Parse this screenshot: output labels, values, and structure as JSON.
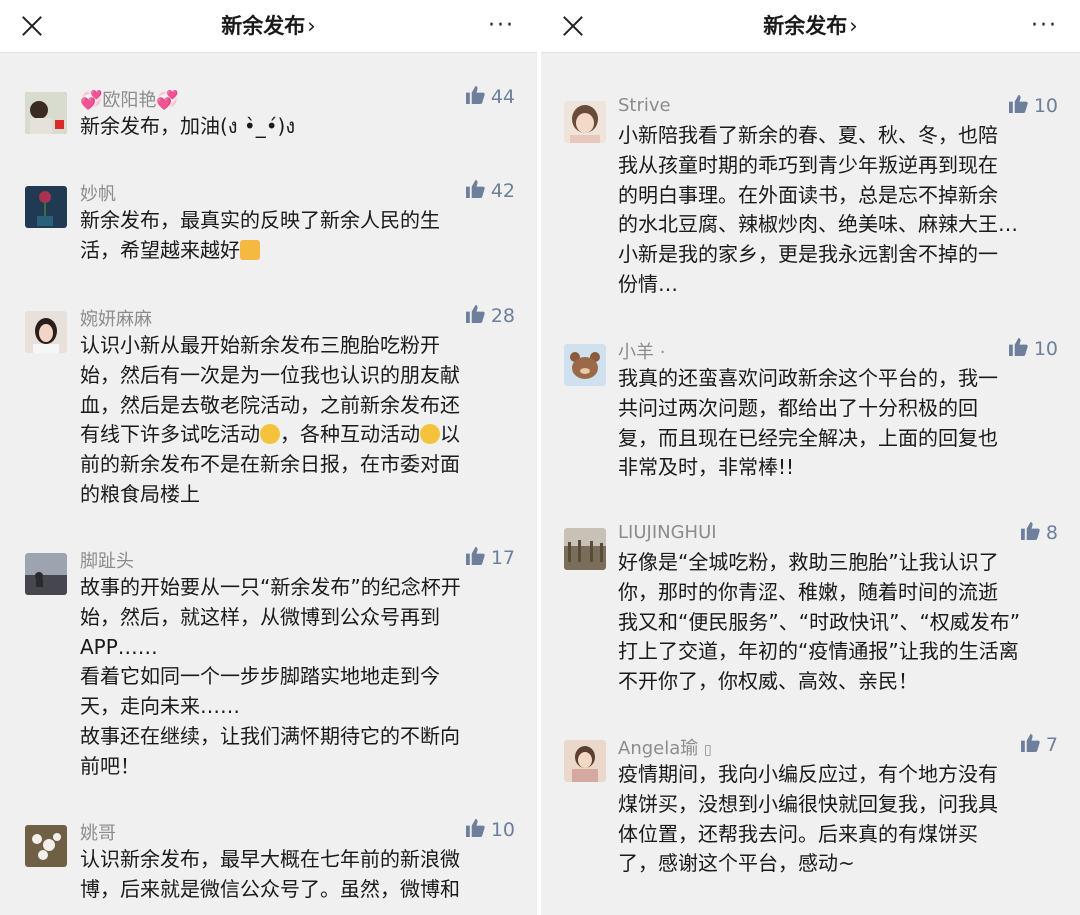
{
  "left": {
    "header": {
      "title": "新余发布",
      "chevron": "›",
      "close_icon": "close-icon",
      "more_icon": "more-icon"
    },
    "comments": [
      {
        "name": "欧阳艳",
        "likes": "44",
        "text": "新余发布，加油(ง •̀_•́)ง",
        "avatar_color": "#4d6a3a"
      },
      {
        "name": "妙帆",
        "likes": "42",
        "text": "新余发布，最真实的反映了新余人民的生\n活，希望越来越好",
        "avatar_color": "#2d4a63"
      },
      {
        "name": "婉妍麻麻",
        "likes": "28",
        "text": "认识小新从最开始新余发布三胞胎吃粉开\n始，然后有一次是为一位我也认识的朋友献\n血，然后是去敬老院活动，之前新余发布还\n有线下许多试吃活动",
        "text2": "，各种互动活动",
        "text3": "以\n前的新余发布不是在新余日报，在市委对面\n的粮食局楼上",
        "avatar_color": "#c9b8b0"
      },
      {
        "name": "脚趾头",
        "likes": "17",
        "text": "故事的开始要从一只“新余发布”的纪念杯开\n始，然后，就这样，从微博到公众号再到\nAPP……\n看着它如同一个一步步脚踏实地地走到今\n天，走向未来……\n故事还在继续，让我们满怀期待它的不断向\n前吧！",
        "avatar_color": "#6d6e78"
      },
      {
        "name": "姚哥",
        "likes": "10",
        "text": "认识新余发布，最早大概在七年前的新浪微\n博，后来就是微信公众号了。虽然，微博和",
        "avatar_color": "#8a7a5a"
      }
    ]
  },
  "right": {
    "header": {
      "title": "新余发布",
      "chevron": "›",
      "close_icon": "close-icon",
      "more_icon": "more-icon"
    },
    "comments": [
      {
        "name": "Strive",
        "likes": "10",
        "text": "小新陪我看了新余的春、夏、秋、冬，也陪\n我从孩童时期的乖巧到青少年叛逆再到现在\n的明白事理。在外面读书，总是忘不掉新余\n的水北豆腐、辣椒炒肉、绝美味、麻辣大王…\n小新是我的家乡，更是我永远割舍不掉的一\n份情…",
        "avatar_color": "#d9b9a5"
      },
      {
        "name": "小羊 ·",
        "likes": "10",
        "text": "我真的还蛮喜欢问政新余这个平台的，我一\n共问过两次问题，都给出了十分积极的回\n复，而且现在已经完全解决，上面的回复也\n非常及时，非常棒!!",
        "avatar_color": "#cfe0ef"
      },
      {
        "name": "LIUJINGHUI",
        "likes": "8",
        "text": "好像是“全城吃粉，救助三胞胎”让我认识了\n你，那时的你青涩、稚嫩，随着时间的流逝\n我又和“便民服务”、“时政快讯”、“权威发布”\n打上了交道，年初的“疫情通报”让我的生活离\n不开你了，你权威、高效、亲民！",
        "avatar_color": "#9a8f7a"
      },
      {
        "name": "Angela瑜",
        "likes": "7",
        "text": "疫情期间，我向小编反应过，有个地方没有\n煤饼买，没想到小编很快就回复我，问我具\n体位置，还帮我去问。后来真的有煤饼买\n了，感谢这个平台，感动~",
        "avatar_color": "#e1c7b5"
      }
    ]
  },
  "colors": {
    "likes": "#6e7f9c",
    "name": "#8c8c8c",
    "background": "#f0f0f0",
    "heart": "#e255a8"
  }
}
